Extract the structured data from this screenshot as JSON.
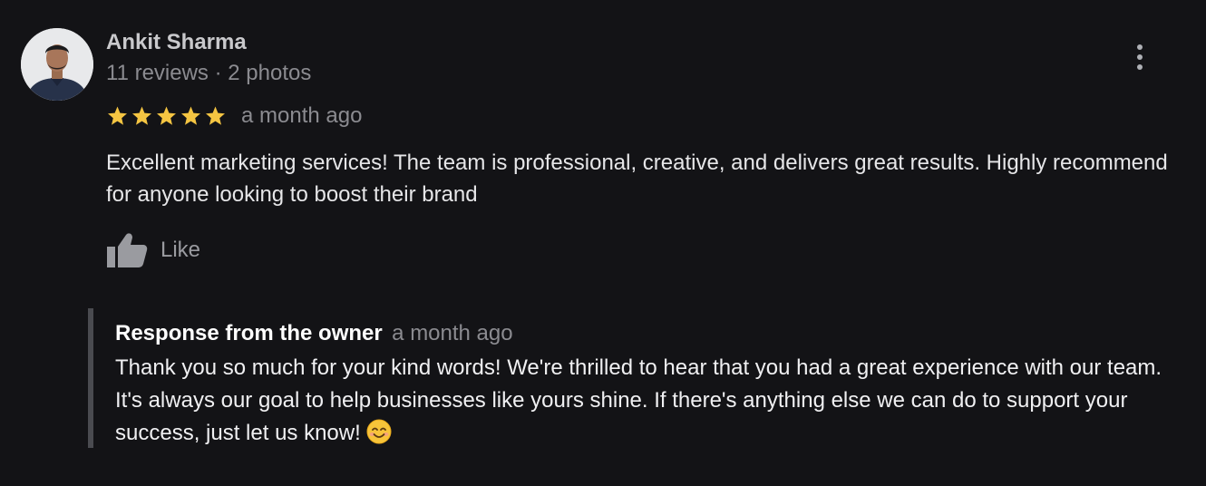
{
  "review": {
    "author": {
      "name": "Ankit Sharma",
      "meta": "11 reviews · 2 photos",
      "avatar_icon": "person-avatar"
    },
    "rating": 5,
    "max_rating": 5,
    "date": "a month ago",
    "text": "Excellent marketing services! The team is professional, creative, and delivers great results. Highly recommend for anyone looking to boost their brand",
    "like_label": "Like",
    "menu_icon": "more-vertical-icon"
  },
  "owner_response": {
    "title": "Response from the owner",
    "date": "a month ago",
    "text": "Thank you so much for your kind words! We're thrilled to hear that you had a great experience with our team. It's always our goal to help businesses like yours shine. If there's anything else we can do to support your success, just let us know!",
    "emoji_icon": "smiling-face-icon"
  },
  "colors": {
    "background": "#131316",
    "star": "#f5c542",
    "muted_text": "#8b8b90",
    "body_text": "#e6e6e8",
    "response_bar": "#4a4b50"
  }
}
